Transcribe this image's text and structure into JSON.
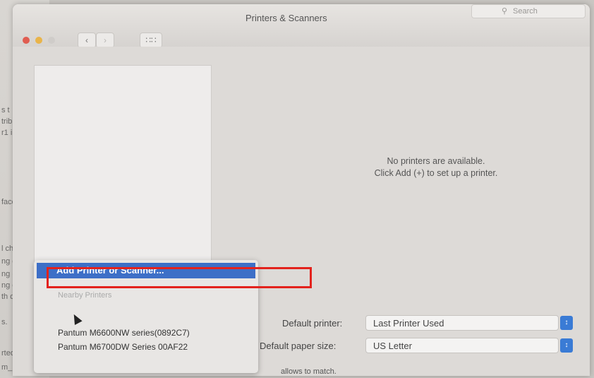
{
  "background_document": {
    "fragments": [
      "s t",
      "trib",
      "r1 i",
      "face",
      "l cher",
      "ng de",
      "ng (a",
      "ng ob",
      "th doc",
      "s.",
      "rted.",
      "m_max."
    ]
  },
  "window": {
    "title": "Printers & Scanners",
    "search_placeholder": "Search",
    "icons": {
      "search": "search-icon",
      "back": "chevron-left-icon",
      "forward": "chevron-right-icon",
      "grid": "grid-icon"
    }
  },
  "printer_list": {
    "add_button_label": "+",
    "empty_message_line1": "No printers are available.",
    "empty_message_line2": "Click Add (+) to set up a printer."
  },
  "add_menu": {
    "selected_item": "Add Printer or Scanner...",
    "section_label": "Nearby Printers",
    "printers": [
      "Pantum M6600NW series(0892C7)",
      "Pantum M6700DW Series 00AF22"
    ]
  },
  "settings": {
    "default_printer_label": "Default printer:",
    "default_printer_value": "Last Printer Used",
    "paper_size_label": "Default paper size:",
    "paper_size_value": "US Letter",
    "footer_text": "allows to match."
  },
  "colors": {
    "selection": "#3d6fc7",
    "highlight_box": "#e3221c",
    "stepper": "#3a7bd5"
  }
}
